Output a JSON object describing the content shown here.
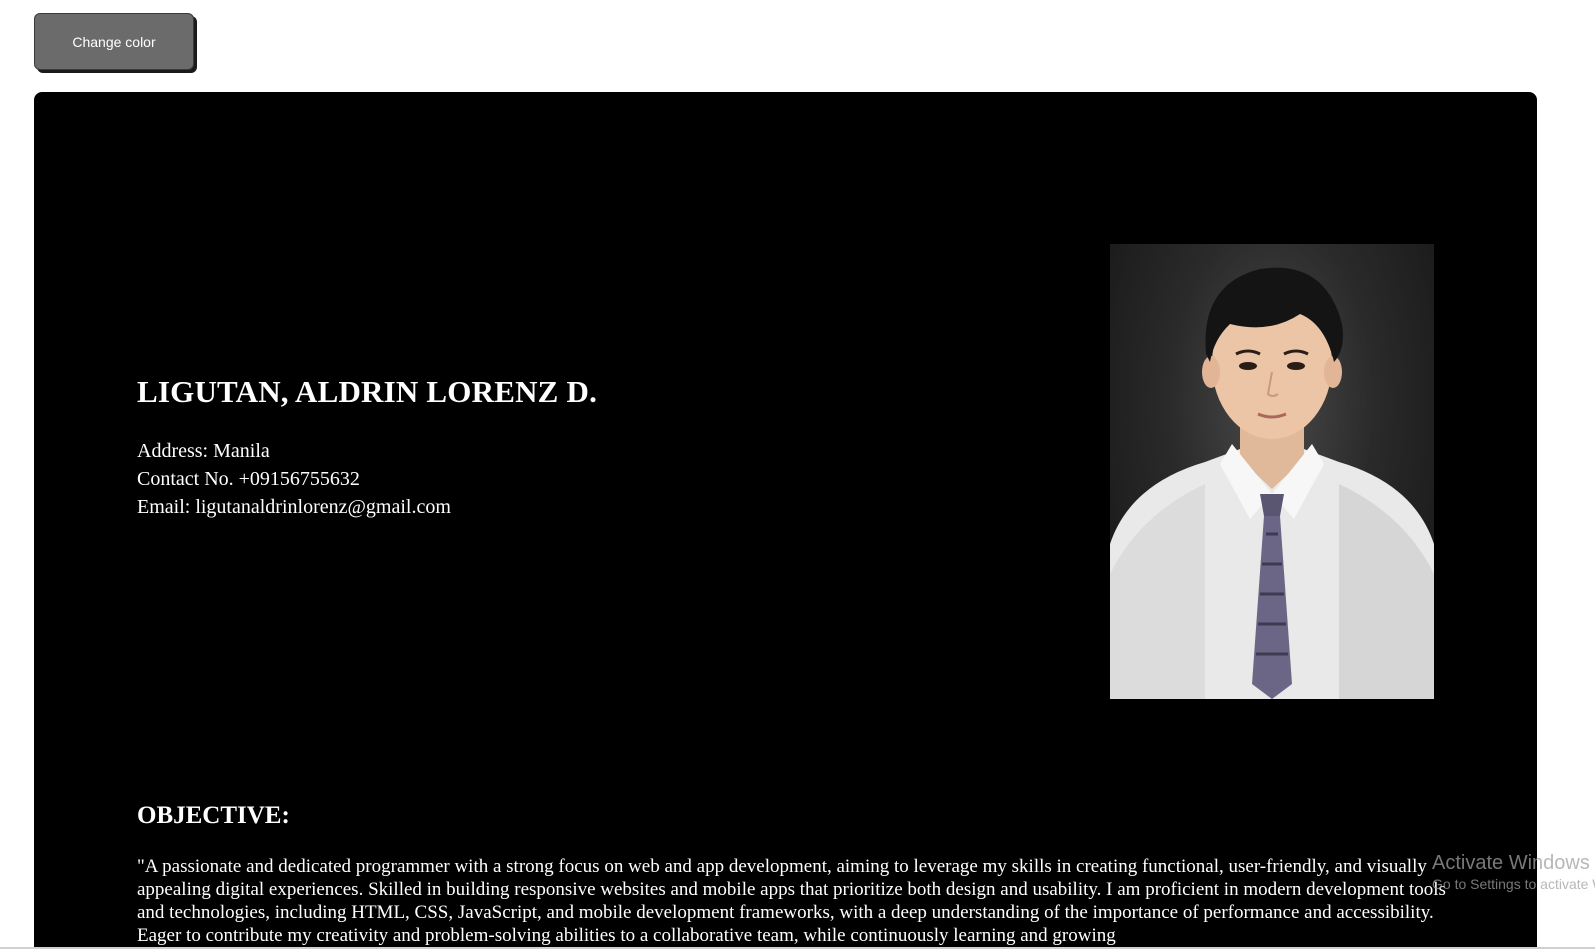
{
  "toolbar": {
    "change_color_label": "Change color"
  },
  "resume": {
    "name": "LIGUTAN, ALDRIN LORENZ D.",
    "address": "Address: Manila",
    "contact": "Contact No. +09156755632",
    "email": "Email: ligutanaldrinlorenz@gmail.com",
    "photo_alt": "Portrait photo",
    "objective_title": "OBJECTIVE:",
    "objective_text": "\"A passionate and dedicated programmer with a strong focus on web and app development, aiming to leverage my skills in creating functional, user-friendly, and visually appealing digital experiences. Skilled in building responsive websites and mobile apps that prioritize both design and usability. I am proficient in modern development tools and technologies, including HTML, CSS, JavaScript, and mobile development frameworks, with a deep understanding of the importance of performance and accessibility. Eager to contribute my creativity and problem-solving abilities to a collaborative team, while continuously learning and growing"
  },
  "watermark": {
    "title": "Activate Windows",
    "subtitle": "Go to Settings to activate Windows."
  },
  "colors": {
    "page_background": "#ffffff",
    "resume_background": "#000000",
    "text": "#ffffff",
    "button_background": "#6b6b6b"
  }
}
